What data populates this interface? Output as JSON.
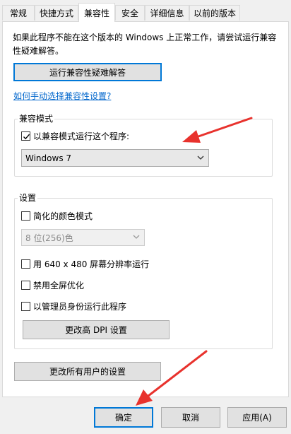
{
  "tabs": [
    {
      "label": "常规"
    },
    {
      "label": "快捷方式"
    },
    {
      "label": "兼容性",
      "active": true
    },
    {
      "label": "安全"
    },
    {
      "label": "详细信息"
    },
    {
      "label": "以前的版本"
    }
  ],
  "info_text": "如果此程序不能在这个版本的 Windows 上正常工作，请尝试运行兼容性疑难解答。",
  "troubleshoot_button": "运行兼容性疑难解答",
  "manual_link": "如何手动选择兼容性设置?",
  "compat_mode": {
    "title": "兼容模式",
    "checkbox_label": "以兼容模式运行这个程序:",
    "checked": true,
    "selected_os": "Windows 7"
  },
  "settings": {
    "title": "设置",
    "reduced_color_label": "简化的颜色模式",
    "color_select_value": "8 位(256)色",
    "resolution_label": "用 640 x 480 屏幕分辨率运行",
    "fullscreen_label": "禁用全屏优化",
    "admin_label": "以管理员身份运行此程序",
    "dpi_button": "更改高 DPI 设置"
  },
  "all_users_button": "更改所有用户的设置",
  "footer": {
    "ok": "确定",
    "cancel": "取消",
    "apply": "应用(A)"
  },
  "colors": {
    "focus_blue": "#0078d7",
    "link_blue": "#0066cc",
    "arrow_red": "#e8322d"
  }
}
